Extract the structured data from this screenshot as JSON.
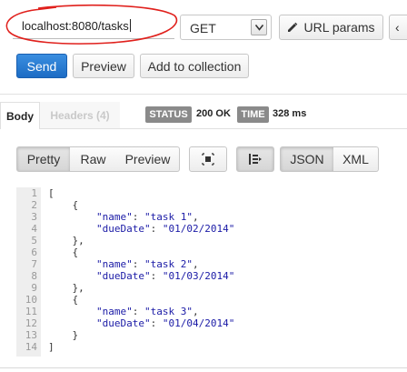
{
  "url": {
    "value": "localhost:8080/tasks"
  },
  "method": {
    "selected": "GET"
  },
  "buttons": {
    "url_params": "URL params",
    "send": "Send",
    "preview": "Preview",
    "add_to_collection": "Add to collection"
  },
  "response_tabs": {
    "body": "Body",
    "headers": "Headers (4)"
  },
  "status": {
    "status_label": "STATUS",
    "status_value": "200 OK",
    "time_label": "TIME",
    "time_value": "328 ms"
  },
  "view_modes": {
    "pretty": "Pretty",
    "raw": "Raw",
    "preview": "Preview",
    "json": "JSON",
    "xml": "XML"
  },
  "icons": {
    "expand": "expand-icon",
    "wrap": "wrap-lines-icon",
    "edit": "pencil-icon",
    "dropdown": "chevron-down-icon"
  },
  "colors": {
    "send_bg": "#1c6cc4",
    "annotation": "#e0201c",
    "json_key": "#1a1aa6"
  },
  "response_lines": [
    "[",
    "    {",
    "        \"name\": \"task 1\",",
    "        \"dueDate\": \"01/02/2014\"",
    "    },",
    "    {",
    "        \"name\": \"task 2\",",
    "        \"dueDate\": \"01/03/2014\"",
    "    },",
    "    {",
    "        \"name\": \"task 3\",",
    "        \"dueDate\": \"01/04/2014\"",
    "    }",
    "]"
  ]
}
